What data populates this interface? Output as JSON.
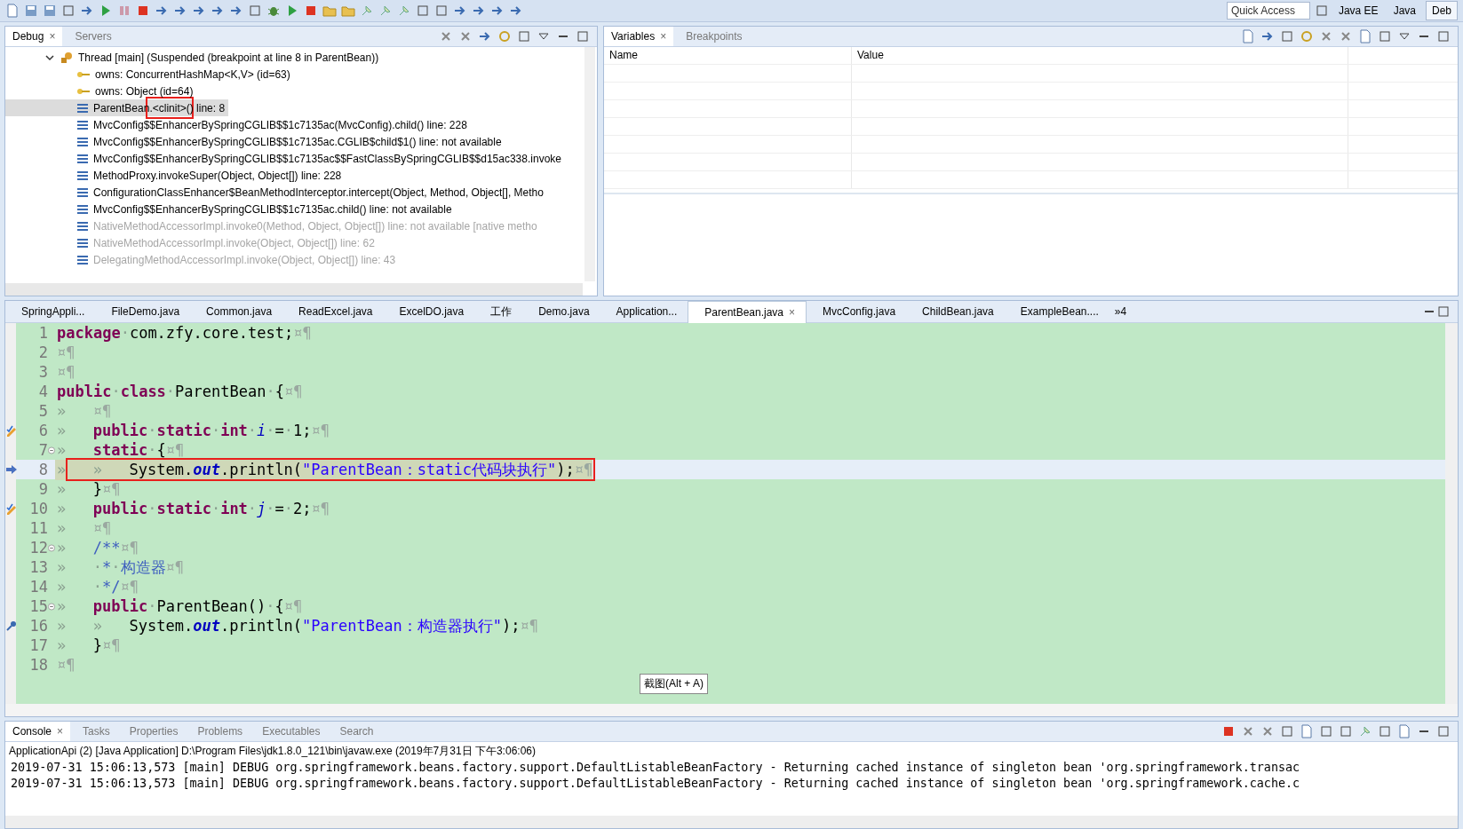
{
  "toolbar": {
    "quick_access": {
      "placeholder": "Quick Access"
    },
    "perspectives": [
      {
        "label": "Java EE",
        "selected": false
      },
      {
        "label": "Java",
        "selected": false
      },
      {
        "label": "Deb",
        "selected": true
      }
    ]
  },
  "debug_view": {
    "tabs": [
      {
        "label": "Debug",
        "selected": true,
        "close": "×"
      },
      {
        "label": "Servers",
        "selected": false
      }
    ],
    "thread": {
      "label": "Thread [main] (Suspended (breakpoint at line 8 in ParentBean))",
      "expanded": true,
      "children": [
        {
          "kind": "lock",
          "label": "owns: ConcurrentHashMap<K,V>  (id=63)",
          "selected": false,
          "dimmed": false,
          "annotated": false
        },
        {
          "kind": "lock",
          "label": "owns: Object  (id=64)",
          "selected": false,
          "dimmed": false,
          "annotated": false
        },
        {
          "kind": "frame",
          "label": "ParentBean.<clinit>() line: 8",
          "selected": true,
          "dimmed": false,
          "annotated": true
        },
        {
          "kind": "frame",
          "label": "MvcConfig$$EnhancerBySpringCGLIB$$1c7135ac(MvcConfig).child() line: 228",
          "selected": false,
          "dimmed": false,
          "annotated": false
        },
        {
          "kind": "frame",
          "label": "MvcConfig$$EnhancerBySpringCGLIB$$1c7135ac.CGLIB$child$1() line: not available",
          "selected": false,
          "dimmed": false,
          "annotated": false
        },
        {
          "kind": "frame",
          "label": "MvcConfig$$EnhancerBySpringCGLIB$$1c7135ac$$FastClassBySpringCGLIB$$d15ac338.invoke",
          "selected": false,
          "dimmed": false,
          "annotated": false
        },
        {
          "kind": "frame",
          "label": "MethodProxy.invokeSuper(Object, Object[]) line: 228",
          "selected": false,
          "dimmed": false,
          "annotated": false
        },
        {
          "kind": "frame",
          "label": "ConfigurationClassEnhancer$BeanMethodInterceptor.intercept(Object, Method, Object[], Metho",
          "selected": false,
          "dimmed": false,
          "annotated": false
        },
        {
          "kind": "frame",
          "label": "MvcConfig$$EnhancerBySpringCGLIB$$1c7135ac.child() line: not available",
          "selected": false,
          "dimmed": false,
          "annotated": false
        },
        {
          "kind": "frame",
          "label": "NativeMethodAccessorImpl.invoke0(Method, Object, Object[]) line: not available [native metho",
          "selected": false,
          "dimmed": true,
          "annotated": false
        },
        {
          "kind": "frame",
          "label": "NativeMethodAccessorImpl.invoke(Object, Object[]) line: 62",
          "selected": false,
          "dimmed": true,
          "annotated": false
        },
        {
          "kind": "frame",
          "label": "DelegatingMethodAccessorImpl.invoke(Object, Object[]) line: 43",
          "selected": false,
          "dimmed": true,
          "annotated": false
        }
      ]
    }
  },
  "variables_view": {
    "tabs": [
      {
        "label": "Variables",
        "selected": true,
        "close": "×"
      },
      {
        "label": "Breakpoints",
        "selected": false
      }
    ],
    "columns": [
      "Name",
      "Value"
    ]
  },
  "editor": {
    "tabs": [
      {
        "label": "SpringAppli...",
        "selected": false
      },
      {
        "label": "FileDemo.java",
        "selected": false
      },
      {
        "label": "Common.java",
        "selected": false
      },
      {
        "label": "ReadExcel.java",
        "selected": false
      },
      {
        "label": "ExcelDO.java",
        "selected": false
      },
      {
        "label": "工作",
        "selected": false
      },
      {
        "label": "Demo.java",
        "selected": false
      },
      {
        "label": "Application...",
        "selected": false
      },
      {
        "label": "ParentBean.java",
        "selected": true,
        "close": "×"
      },
      {
        "label": "MvcConfig.java",
        "selected": false
      },
      {
        "label": "ChildBean.java",
        "selected": false
      },
      {
        "label": "ExampleBean....",
        "selected": false
      }
    ],
    "overflow": "»4",
    "lines": [
      {
        "number": "1",
        "watchpoint": false,
        "occurrence": false,
        "fold": false,
        "current": false,
        "tokens": [
          {
            "kind": "kw",
            "text": "package"
          },
          {
            "kind": "ws",
            "text": "·"
          },
          {
            "kind": "plain",
            "text": "com.zfy.core.test;"
          },
          {
            "kind": "eol",
            "text": "¤¶"
          }
        ]
      },
      {
        "number": "2",
        "watchpoint": false,
        "occurrence": false,
        "fold": false,
        "current": false,
        "tokens": [
          {
            "kind": "eol",
            "text": "¤¶"
          }
        ]
      },
      {
        "number": "3",
        "watchpoint": false,
        "occurrence": false,
        "fold": false,
        "current": false,
        "tokens": [
          {
            "kind": "eol",
            "text": "¤¶"
          }
        ]
      },
      {
        "number": "4",
        "watchpoint": false,
        "occurrence": false,
        "fold": false,
        "current": false,
        "tokens": [
          {
            "kind": "kw",
            "text": "public"
          },
          {
            "kind": "ws",
            "text": "·"
          },
          {
            "kind": "kw",
            "text": "class"
          },
          {
            "kind": "ws",
            "text": "·"
          },
          {
            "kind": "plain",
            "text": "ParentBean"
          },
          {
            "kind": "ws",
            "text": "·"
          },
          {
            "kind": "plain",
            "text": "{"
          },
          {
            "kind": "eol",
            "text": "¤¶"
          }
        ]
      },
      {
        "number": "5",
        "watchpoint": false,
        "occurrence": false,
        "fold": false,
        "current": false,
        "tokens": [
          {
            "kind": "tab",
            "text": "»"
          },
          {
            "kind": "eol",
            "text": "¤¶"
          }
        ]
      },
      {
        "number": "6",
        "watchpoint": true,
        "occurrence": false,
        "fold": false,
        "current": false,
        "tokens": [
          {
            "kind": "tab",
            "text": "»"
          },
          {
            "kind": "kw",
            "text": "public"
          },
          {
            "kind": "ws",
            "text": "·"
          },
          {
            "kind": "kw",
            "text": "static"
          },
          {
            "kind": "ws",
            "text": "·"
          },
          {
            "kind": "kw",
            "text": "int"
          },
          {
            "kind": "ws",
            "text": "·"
          },
          {
            "kind": "var",
            "text": "i"
          },
          {
            "kind": "ws",
            "text": "·"
          },
          {
            "kind": "plain",
            "text": "="
          },
          {
            "kind": "ws",
            "text": "·"
          },
          {
            "kind": "plain",
            "text": "1;"
          },
          {
            "kind": "eol",
            "text": "¤¶"
          }
        ]
      },
      {
        "number": "7",
        "watchpoint": false,
        "occurrence": false,
        "fold": true,
        "current": false,
        "tokens": [
          {
            "kind": "tab",
            "text": "»"
          },
          {
            "kind": "kw",
            "text": "static"
          },
          {
            "kind": "ws",
            "text": "·"
          },
          {
            "kind": "plain",
            "text": "{"
          },
          {
            "kind": "eol",
            "text": "¤¶"
          }
        ]
      },
      {
        "number": "8",
        "watchpoint": false,
        "occurrence": false,
        "fold": false,
        "current": true,
        "tokens": [
          {
            "kind": "tab",
            "text": "»"
          },
          {
            "kind": "tab",
            "text": "»"
          },
          {
            "kind": "plain",
            "text": "System."
          },
          {
            "kind": "field",
            "text": "out"
          },
          {
            "kind": "plain",
            "text": ".println("
          },
          {
            "kind": "str",
            "text": "\"ParentBean：static代码块执行\""
          },
          {
            "kind": "plain",
            "text": ");"
          },
          {
            "kind": "eol",
            "text": "¤¶"
          }
        ]
      },
      {
        "number": "9",
        "watchpoint": false,
        "occurrence": false,
        "fold": false,
        "current": false,
        "tokens": [
          {
            "kind": "tab",
            "text": "»"
          },
          {
            "kind": "plain",
            "text": "}"
          },
          {
            "kind": "eol",
            "text": "¤¶"
          }
        ]
      },
      {
        "number": "10",
        "watchpoint": true,
        "occurrence": false,
        "fold": false,
        "current": false,
        "tokens": [
          {
            "kind": "tab",
            "text": "»"
          },
          {
            "kind": "kw",
            "text": "public"
          },
          {
            "kind": "ws",
            "text": "·"
          },
          {
            "kind": "kw",
            "text": "static"
          },
          {
            "kind": "ws",
            "text": "·"
          },
          {
            "kind": "kw",
            "text": "int"
          },
          {
            "kind": "ws",
            "text": "·"
          },
          {
            "kind": "var",
            "text": "j"
          },
          {
            "kind": "ws",
            "text": "·"
          },
          {
            "kind": "plain",
            "text": "="
          },
          {
            "kind": "ws",
            "text": "·"
          },
          {
            "kind": "plain",
            "text": "2;"
          },
          {
            "kind": "eol",
            "text": "¤¶"
          }
        ]
      },
      {
        "number": "11",
        "watchpoint": false,
        "occurrence": false,
        "fold": false,
        "current": false,
        "tokens": [
          {
            "kind": "tab",
            "text": "»"
          },
          {
            "kind": "eol",
            "text": "¤¶"
          }
        ]
      },
      {
        "number": "12",
        "watchpoint": false,
        "occurrence": false,
        "fold": true,
        "current": false,
        "tokens": [
          {
            "kind": "tab",
            "text": "»"
          },
          {
            "kind": "comment",
            "text": "/**"
          },
          {
            "kind": "eol",
            "text": "¤¶"
          }
        ]
      },
      {
        "number": "13",
        "watchpoint": false,
        "occurrence": false,
        "fold": false,
        "current": false,
        "tokens": [
          {
            "kind": "tab",
            "text": "»"
          },
          {
            "kind": "ws",
            "text": "·"
          },
          {
            "kind": "comment",
            "text": "*"
          },
          {
            "kind": "ws",
            "text": "·"
          },
          {
            "kind": "comment",
            "text": "构造器"
          },
          {
            "kind": "eol",
            "text": "¤¶"
          }
        ]
      },
      {
        "number": "14",
        "watchpoint": false,
        "occurrence": false,
        "fold": false,
        "current": false,
        "tokens": [
          {
            "kind": "tab",
            "text": "»"
          },
          {
            "kind": "ws",
            "text": "·"
          },
          {
            "kind": "comment",
            "text": "*/"
          },
          {
            "kind": "eol",
            "text": "¤¶"
          }
        ]
      },
      {
        "number": "15",
        "watchpoint": false,
        "occurrence": false,
        "fold": true,
        "current": false,
        "tokens": [
          {
            "kind": "tab",
            "text": "»"
          },
          {
            "kind": "kw",
            "text": "public"
          },
          {
            "kind": "ws",
            "text": "·"
          },
          {
            "kind": "plain",
            "text": "ParentBean()"
          },
          {
            "kind": "ws",
            "text": "·"
          },
          {
            "kind": "plain",
            "text": "{"
          },
          {
            "kind": "eol",
            "text": "¤¶"
          }
        ]
      },
      {
        "number": "16",
        "watchpoint": false,
        "occurrence": true,
        "fold": false,
        "current": false,
        "tokens": [
          {
            "kind": "tab",
            "text": "»"
          },
          {
            "kind": "tab",
            "text": "»"
          },
          {
            "kind": "plain",
            "text": "System."
          },
          {
            "kind": "field",
            "text": "out"
          },
          {
            "kind": "plain",
            "text": ".println("
          },
          {
            "kind": "str",
            "text": "\"ParentBean：构造器执行\""
          },
          {
            "kind": "plain",
            "text": ");"
          },
          {
            "kind": "eol",
            "text": "¤¶"
          }
        ]
      },
      {
        "number": "17",
        "watchpoint": false,
        "occurrence": false,
        "fold": false,
        "current": false,
        "tokens": [
          {
            "kind": "tab",
            "text": "»"
          },
          {
            "kind": "plain",
            "text": "}"
          },
          {
            "kind": "eol",
            "text": "¤¶"
          }
        ]
      },
      {
        "number": "18",
        "watchpoint": false,
        "occurrence": false,
        "fold": false,
        "current": false,
        "tokens": [
          {
            "kind": "eol",
            "text": "¤¶"
          }
        ]
      }
    ],
    "tooltip": "截图(Alt + A)"
  },
  "console_view": {
    "tabs": [
      {
        "label": "Console",
        "selected": true,
        "close": "×"
      },
      {
        "label": "Tasks",
        "selected": false
      },
      {
        "label": "Properties",
        "selected": false
      },
      {
        "label": "Problems",
        "selected": false
      },
      {
        "label": "Executables",
        "selected": false
      },
      {
        "label": "Search",
        "selected": false
      }
    ],
    "process": "ApplicationApi (2) [Java Application] D:\\Program Files\\jdk1.8.0_121\\bin\\javaw.exe (2019年7月31日 下午3:06:06)",
    "lines": [
      "2019-07-31 15:06:13,573 [main] DEBUG org.springframework.beans.factory.support.DefaultListableBeanFactory - Returning cached instance of singleton bean 'org.springframework.transac",
      "2019-07-31 15:06:13,573 [main] DEBUG org.springframework.beans.factory.support.DefaultListableBeanFactory - Returning cached instance of singleton bean 'org.springframework.cache.c"
    ]
  }
}
